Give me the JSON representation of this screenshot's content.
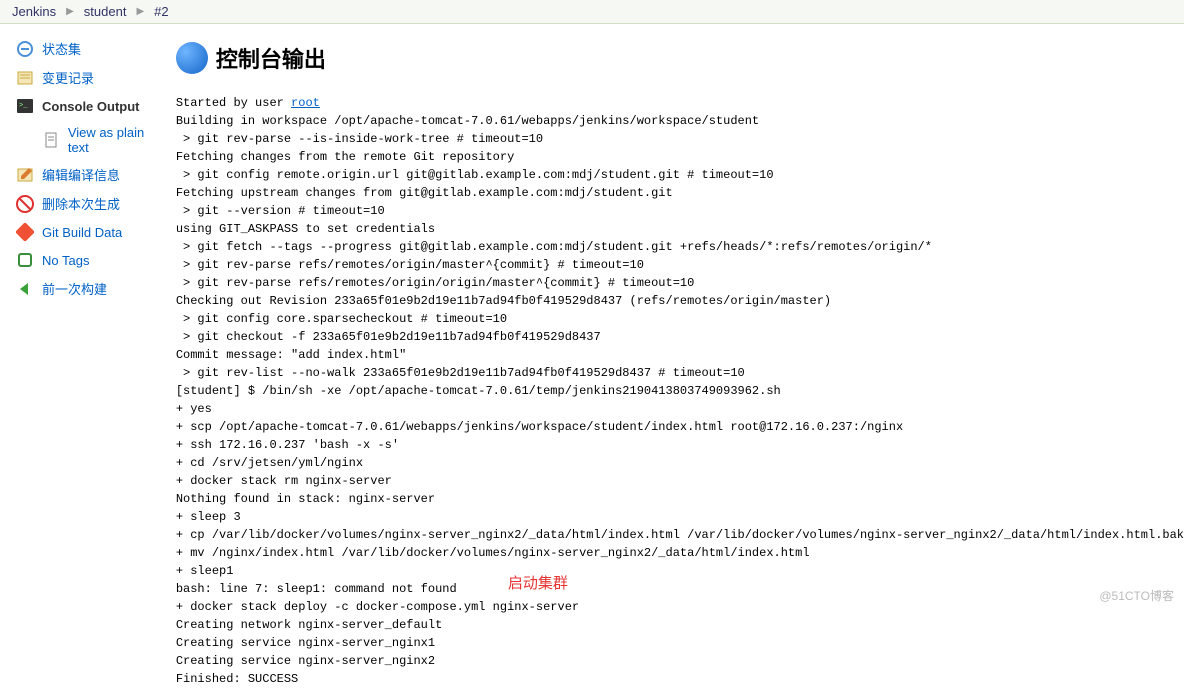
{
  "breadcrumb": {
    "items": [
      "Jenkins",
      "student",
      "#2"
    ]
  },
  "sidebar": {
    "items": [
      {
        "label": "状态集",
        "icon": "status"
      },
      {
        "label": "变更记录",
        "icon": "changes"
      },
      {
        "label": "Console Output",
        "icon": "console",
        "active": true
      },
      {
        "label": "View as plain text",
        "icon": "plaintext",
        "sub": true
      },
      {
        "label": "编辑编译信息",
        "icon": "edit"
      },
      {
        "label": "删除本次生成",
        "icon": "delete"
      },
      {
        "label": "Git Build Data",
        "icon": "git"
      },
      {
        "label": "No Tags",
        "icon": "tags"
      },
      {
        "label": "前一次构建",
        "icon": "prev"
      }
    ]
  },
  "header": {
    "title": "控制台输出"
  },
  "console": {
    "started_prefix": "Started by user ",
    "started_user": "root",
    "lines": "Building in workspace /opt/apache-tomcat-7.0.61/webapps/jenkins/workspace/student\n > git rev-parse --is-inside-work-tree # timeout=10\nFetching changes from the remote Git repository\n > git config remote.origin.url git@gitlab.example.com:mdj/student.git # timeout=10\nFetching upstream changes from git@gitlab.example.com:mdj/student.git\n > git --version # timeout=10\nusing GIT_ASKPASS to set credentials\n > git fetch --tags --progress git@gitlab.example.com:mdj/student.git +refs/heads/*:refs/remotes/origin/*\n > git rev-parse refs/remotes/origin/master^{commit} # timeout=10\n > git rev-parse refs/remotes/origin/origin/master^{commit} # timeout=10\nChecking out Revision 233a65f01e9b2d19e11b7ad94fb0f419529d8437 (refs/remotes/origin/master)\n > git config core.sparsecheckout # timeout=10\n > git checkout -f 233a65f01e9b2d19e11b7ad94fb0f419529d8437\nCommit message: \"add index.html\"\n > git rev-list --no-walk 233a65f01e9b2d19e11b7ad94fb0f419529d8437 # timeout=10\n[student] $ /bin/sh -xe /opt/apache-tomcat-7.0.61/temp/jenkins2190413803749093962.sh\n+ yes\n+ scp /opt/apache-tomcat-7.0.61/webapps/jenkins/workspace/student/index.html root@172.16.0.237:/nginx\n+ ssh 172.16.0.237 'bash -x -s'\n+ cd /srv/jetsen/yml/nginx\n+ docker stack rm nginx-server\nNothing found in stack: nginx-server\n+ sleep 3\n+ cp /var/lib/docker/volumes/nginx-server_nginx2/_data/html/index.html /var/lib/docker/volumes/nginx-server_nginx2/_data/html/index.html.bak\n+ mv /nginx/index.html /var/lib/docker/volumes/nginx-server_nginx2/_data/html/index.html\n+ sleep1\nbash: line 7: sleep1: command not found\n+ docker stack deploy -c docker-compose.yml nginx-server\nCreating network nginx-server_default\nCreating service nginx-server_nginx1\nCreating service nginx-server_nginx2\nFinished: SUCCESS"
  },
  "annotation": "启动集群",
  "watermark": "@51CTO博客"
}
